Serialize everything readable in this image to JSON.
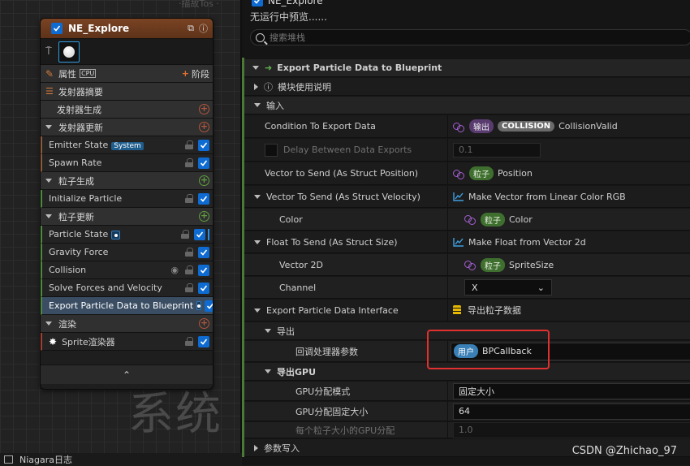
{
  "graph": {
    "top_fragment": "·描故Tos ·",
    "watermark": "系统",
    "node": {
      "title": "NE_Explore",
      "props_label": "属性",
      "cpu_label": "CPU",
      "stage_label": "阶段",
      "emitter_summary": "发射器摘要",
      "emitter_spawn": "发射器生成",
      "emitter_update": "发射器更新",
      "emitter_state": "Emitter State",
      "system_badge": "System",
      "spawn_rate": "Spawn Rate",
      "particle_spawn": "粒子生成",
      "initialize_particle": "Initialize Particle",
      "particle_update": "粒子更新",
      "particle_state": "Particle State",
      "gravity_force": "Gravity Force",
      "collision": "Collision",
      "solve_forces": "Solve Forces and Velocity",
      "export_module": "Export Particle Data to Blueprint",
      "render": "渲染",
      "sprite_renderer": "Sprite渲染器",
      "collapse": "⌃"
    }
  },
  "status": {
    "log_label": "Niagara日志"
  },
  "panel": {
    "top_name": "NE_Explore",
    "preview": "无运行中预览......",
    "search_placeholder": "搜索堆栈",
    "rows": {
      "module_title": "Export Particle Data to Blueprint",
      "module_usage": "模块使用说明",
      "inputs": "输入",
      "condition": "Condition To Export Data",
      "condition_pill1": "输出",
      "condition_pill2": "COLLISION",
      "condition_val": "CollisionValid",
      "delay": "Delay Between Data Exports",
      "delay_val": "0.1",
      "vec_pos": "Vector to Send (As Struct Position)",
      "vec_pos_pill": "粒子",
      "vec_pos_val": "Position",
      "vec_vel": "Vector To Send (As Struct Velocity)",
      "vec_vel_val": "Make Vector from Linear Color RGB",
      "color": "Color",
      "color_pill": "粒子",
      "color_val": "Color",
      "float_size": "Float To Send (As Struct Size)",
      "float_size_val": "Make Float from Vector 2d",
      "vector2d": "Vector 2D",
      "vector2d_pill": "粒子",
      "vector2d_val": "SpriteSize",
      "channel": "Channel",
      "channel_val": "X",
      "interface": "Export Particle Data Interface",
      "interface_val": "导出粒子数据",
      "export": "导出",
      "callback": "回调处理器参数",
      "callback_pill": "用户",
      "callback_val": "BPCallback",
      "export_gpu": "导出GPU",
      "gpu_mode": "GPU分配模式",
      "gpu_mode_val": "固定大小",
      "gpu_fixed": "GPU分配固定大小",
      "gpu_fixed_val": "64",
      "gpu_per": "每个粒子大小的GPU分配",
      "gpu_per_val": "1.0",
      "param_write": "参数写入"
    },
    "credit": "CSDN @Zhichao_97"
  }
}
